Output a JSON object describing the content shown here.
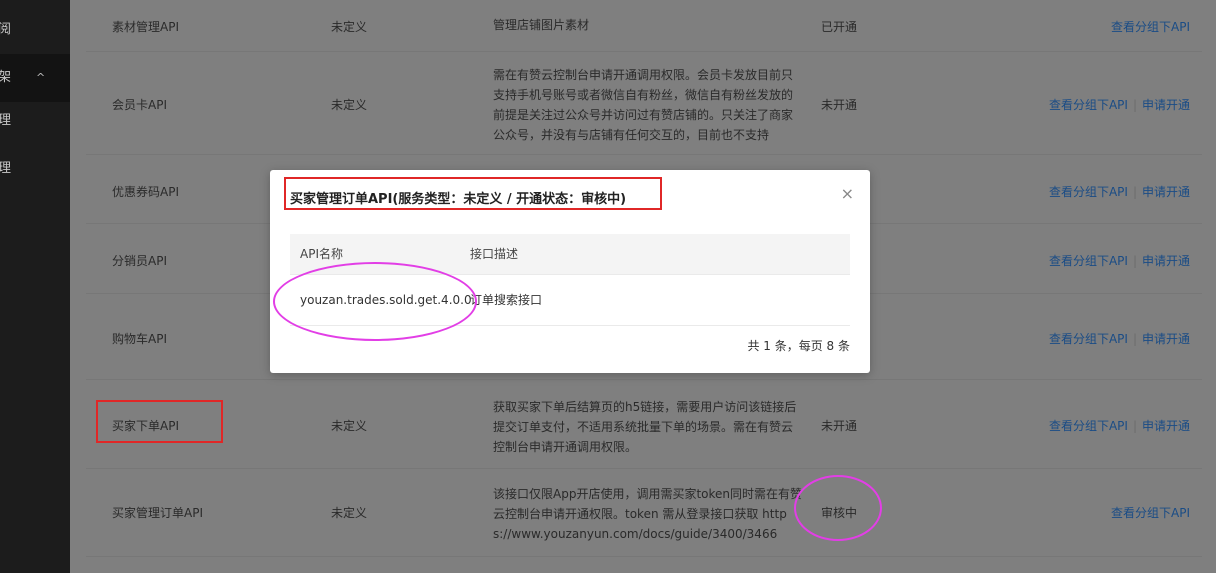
{
  "sidebar": {
    "items": [
      {
        "label": "阅"
      },
      {
        "label": "架",
        "chevron": "^"
      },
      {
        "label": "理"
      },
      {
        "label": "理"
      }
    ]
  },
  "table": {
    "rows": [
      {
        "name": "素材管理API",
        "type": "未定义",
        "desc": "管理店铺图片素材",
        "state": "已开通",
        "ops": [
          "查看分组下API"
        ]
      },
      {
        "name": "会员卡API",
        "type": "未定义",
        "desc": "需在有赞云控制台申请开通调用权限。会员卡发放目前只支持手机号账号或者微信自有粉丝，微信自有粉丝发放的前提是关注过公众号并访问过有赞店铺的。只关注了商家公众号，并没有与店铺有任何交互的，目前也不支持",
        "state": "未开通",
        "ops": [
          "查看分组下API",
          "申请开通"
        ]
      },
      {
        "name": "优惠券码API",
        "type": "",
        "desc": "",
        "state": "",
        "ops": [
          "查看分组下API",
          "申请开通"
        ]
      },
      {
        "name": "分销员API",
        "type": "",
        "desc": "",
        "state": "",
        "ops": [
          "查看分组下API",
          "申请开通"
        ]
      },
      {
        "name": "购物车API",
        "type": "",
        "desc": "",
        "state": "",
        "ops": [
          "查看分组下API",
          "申请开通"
        ]
      },
      {
        "name": "买家下单API",
        "type": "未定义",
        "desc": "获取买家下单后结算页的h5链接，需要用户访问该链接后提交订单支付，不适用系统批量下单的场景。需在有赞云控制台申请开通调用权限。",
        "state": "未开通",
        "ops": [
          "查看分组下API",
          "申请开通"
        ]
      },
      {
        "name": "买家管理订单API",
        "type": "未定义",
        "desc": "该接口仅限App开店使用，调用需买家token同时需在有赞云控制台申请开通权限。token 需从登录接口获取 https://www.youzanyun.com/docs/guide/3400/3466",
        "state": "审核中",
        "ops": [
          "查看分组下API"
        ]
      }
    ]
  },
  "modal": {
    "title": "买家管理订单API(服务类型：未定义 / 开通状态：审核中)",
    "close": "×",
    "columns": [
      "API名称",
      "接口描述"
    ],
    "rows": [
      {
        "api": "youzan.trades.sold.get.4.0.0",
        "desc": "订单搜索接口"
      }
    ],
    "footer": "共 1 条，每页 8 条"
  },
  "colors": {
    "link": "#1a4c86",
    "annotation_red": "#e02727",
    "annotation_pink": "#e23ee6",
    "overlay": "#7f7f7f"
  }
}
